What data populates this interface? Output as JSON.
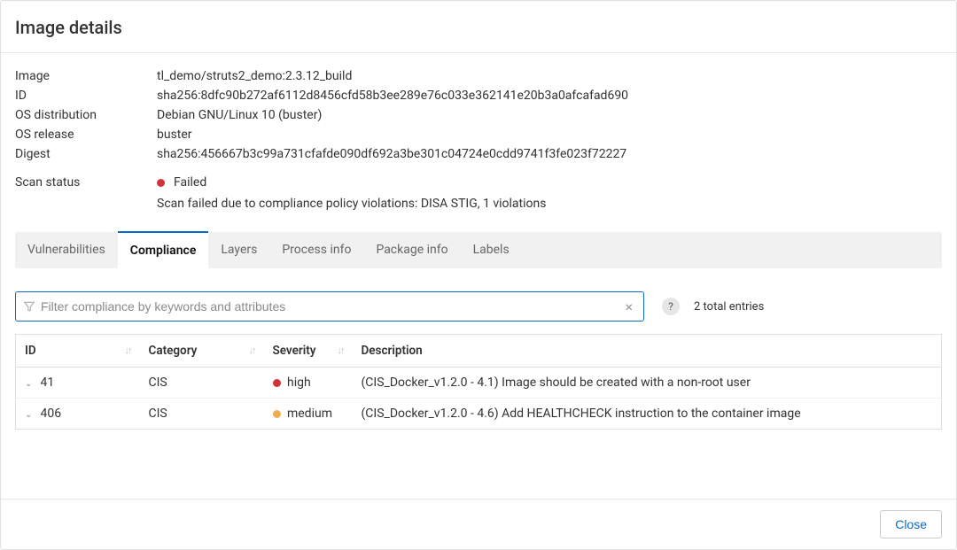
{
  "modal": {
    "title": "Image details",
    "close_label": "Close"
  },
  "details": {
    "image_label": "Image",
    "image_value": "tl_demo/struts2_demo:2.3.12_build",
    "id_label": "ID",
    "id_value": "sha256:8dfc90b272af6112d8456cfd58b3ee289e76c033e362141e20b3a0afcafad690",
    "os_dist_label": "OS distribution",
    "os_dist_value": "Debian GNU/Linux 10 (buster)",
    "os_release_label": "OS release",
    "os_release_value": "buster",
    "digest_label": "Digest",
    "digest_value": "sha256:456667b3c99a731cfafde090df692a3be301c04724e0cdd9741f3fe023f72227",
    "scan_status_label": "Scan status",
    "scan_status_value": "Failed",
    "scan_status_reason": "Scan failed due to compliance policy violations: DISA STIG, 1 violations"
  },
  "tabs": {
    "vulnerabilities": "Vulnerabilities",
    "compliance": "Compliance",
    "layers": "Layers",
    "process_info": "Process info",
    "package_info": "Package info",
    "labels": "Labels",
    "active": "compliance"
  },
  "filter": {
    "placeholder": "Filter compliance by keywords and attributes",
    "value": "",
    "total_entries": "2 total entries",
    "help": "?"
  },
  "table": {
    "headers": {
      "id": "ID",
      "category": "Category",
      "severity": "Severity",
      "description": "Description"
    },
    "rows": [
      {
        "id": "41",
        "category": "CIS",
        "severity": "high",
        "severity_color": "red",
        "description": "(CIS_Docker_v1.2.0 - 4.1) Image should be created with a non-root user"
      },
      {
        "id": "406",
        "category": "CIS",
        "severity": "medium",
        "severity_color": "orange",
        "description": "(CIS_Docker_v1.2.0 - 4.6) Add HEALTHCHECK instruction to the container image"
      }
    ]
  }
}
